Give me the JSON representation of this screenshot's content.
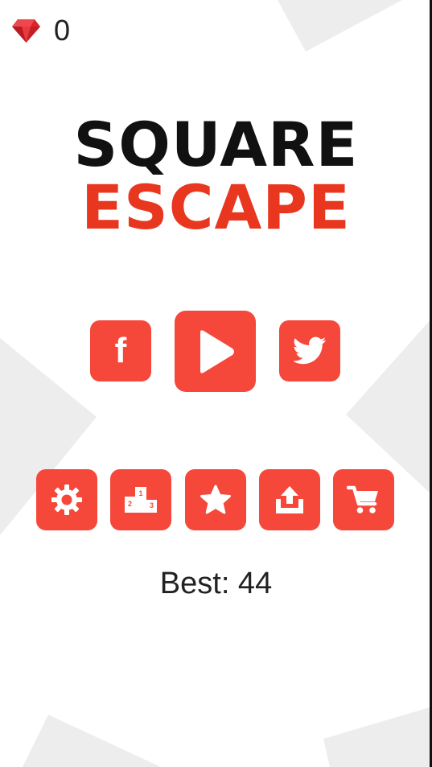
{
  "hud": {
    "gem_icon": "ruby-gem-icon",
    "gem_count": "0"
  },
  "title": {
    "line1": "SQUARE",
    "line2": "ESCAPE"
  },
  "main_buttons": [
    {
      "name": "facebook-button",
      "icon": "facebook-icon",
      "glyph": "f"
    },
    {
      "name": "play-button",
      "icon": "play-icon"
    },
    {
      "name": "twitter-button",
      "icon": "twitter-icon"
    }
  ],
  "menu_buttons": [
    {
      "name": "settings-button",
      "icon": "gear-icon"
    },
    {
      "name": "leaderboard-button",
      "icon": "podium-icon",
      "ranks": [
        "1",
        "2",
        "3"
      ]
    },
    {
      "name": "rate-button",
      "icon": "star-icon"
    },
    {
      "name": "share-button",
      "icon": "share-upload-icon"
    },
    {
      "name": "shop-button",
      "icon": "cart-icon"
    }
  ],
  "best": {
    "label": "Best: 44"
  },
  "colors": {
    "accent": "#F5473A",
    "title_dark": "#111111",
    "title_red": "#E8361F",
    "background": "#FFFFFF",
    "background_shapes": "#EDEDED",
    "gem": "#D9262C"
  }
}
